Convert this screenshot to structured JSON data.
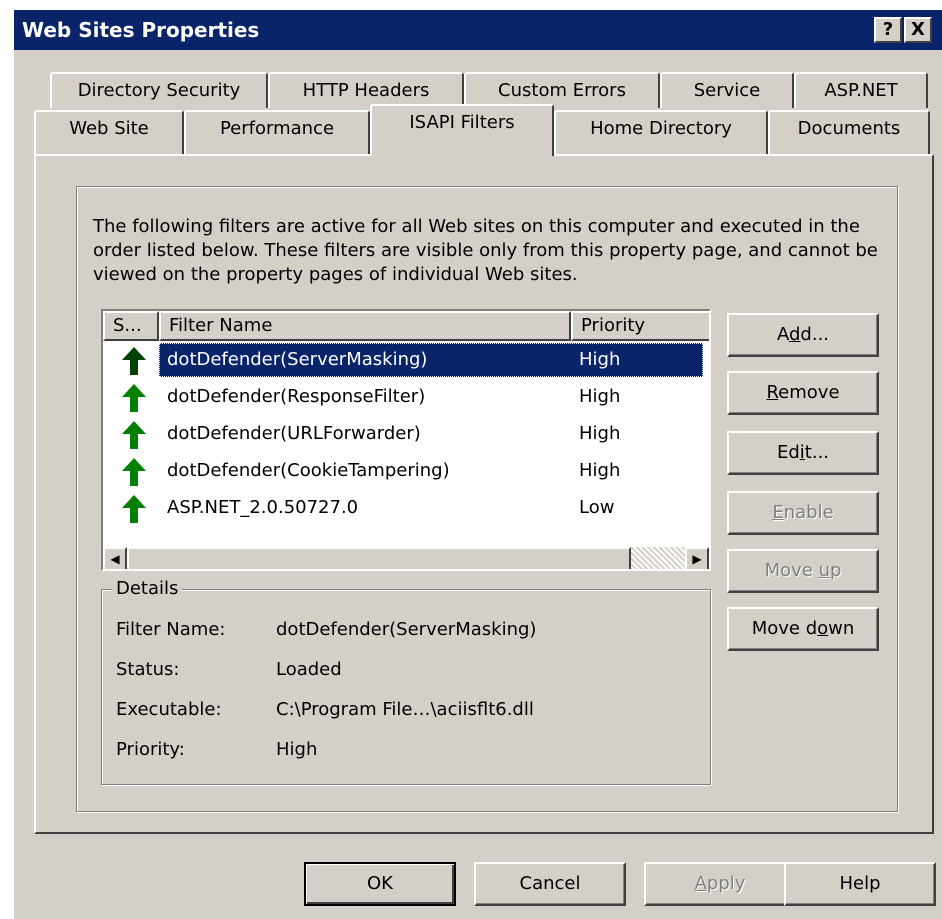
{
  "window": {
    "title": "Web Sites Properties",
    "help_button": "?",
    "close_button": "X"
  },
  "tabs": {
    "row_back": [
      "Directory Security",
      "HTTP Headers",
      "Custom Errors",
      "Service",
      "ASP.NET"
    ],
    "row_front": [
      "Web Site",
      "Performance",
      "ISAPI Filters",
      "Home Directory",
      "Documents"
    ],
    "active": "ISAPI Filters"
  },
  "description": "The following filters are active for all Web sites on this computer and executed in the order listed below. These filters are visible only from this property page, and cannot be viewed on the property pages of individual Web sites.",
  "filter_list": {
    "columns": [
      "S...",
      "Filter Name",
      "Priority"
    ],
    "rows": [
      {
        "name": "dotDefender(ServerMasking)",
        "priority": "High"
      },
      {
        "name": "dotDefender(ResponseFilter)",
        "priority": "High"
      },
      {
        "name": "dotDefender(URLForwarder)",
        "priority": "High"
      },
      {
        "name": "dotDefender(CookieTampering)",
        "priority": "High"
      },
      {
        "name": "ASP.NET_2.0.50727.0",
        "priority": "Low"
      }
    ],
    "selected_index": 0,
    "status_icon": "green-up-arrow-icon",
    "status_color": "#008000"
  },
  "details": {
    "legend": "Details",
    "labels": {
      "filter_name": "Filter Name:",
      "status": "Status:",
      "executable": "Executable:",
      "priority": "Priority:"
    },
    "values": {
      "filter_name": "dotDefender(ServerMasking)",
      "status": "Loaded",
      "executable": "C:\\Program File…\\aciisflt6.dll",
      "priority": "High"
    }
  },
  "side_buttons": {
    "add": {
      "pre": "A",
      "key": "d",
      "post": "d..."
    },
    "remove": {
      "pre": "",
      "key": "R",
      "post": "emove"
    },
    "edit": {
      "pre": "Ed",
      "key": "i",
      "post": "t..."
    },
    "enable": {
      "pre": "",
      "key": "E",
      "post": "nable"
    },
    "move_up": {
      "pre": "Move ",
      "key": "u",
      "post": "p"
    },
    "move_down": {
      "pre": "Move d",
      "key": "o",
      "post": "wn"
    }
  },
  "footer_buttons": {
    "ok": "OK",
    "cancel": "Cancel",
    "apply": {
      "pre": "",
      "key": "A",
      "post": "pply"
    },
    "help": "Help"
  },
  "colors": {
    "title_bar": "#0a246a",
    "selection": "#0a246a",
    "face": "#d4d0c8"
  }
}
